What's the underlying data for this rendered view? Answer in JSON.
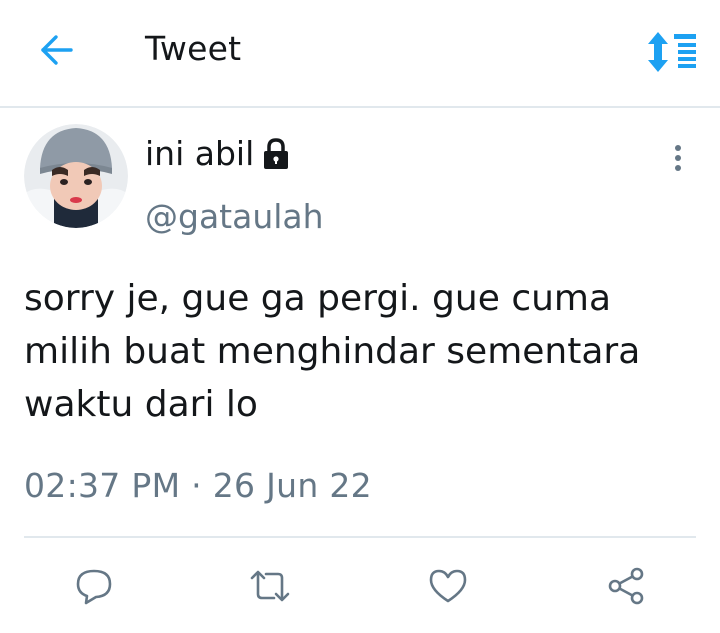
{
  "header": {
    "title": "Tweet",
    "back_icon": "arrow-left-icon",
    "sort_icon": "sort-icon",
    "accent_color": "#1da1f2"
  },
  "tweet": {
    "author": {
      "display_name": "ini abil",
      "handle": "@gataulah",
      "protected_icon": "lock-icon"
    },
    "text": "sorry je, gue ga pergi.  gue cuma\nmilih buat menghindar sementara\nwaktu dari lo",
    "timestamp": "02:37 PM · 26 Jun 22",
    "more_icon": "more-vertical-icon"
  },
  "actions": [
    {
      "name": "reply",
      "icon": "reply-icon"
    },
    {
      "name": "retweet",
      "icon": "retweet-icon"
    },
    {
      "name": "like",
      "icon": "heart-icon"
    },
    {
      "name": "share",
      "icon": "share-icon"
    }
  ],
  "colors": {
    "text_primary": "#14171a",
    "text_secondary": "#657786",
    "divider": "#e1e8ed",
    "icon_gray": "#657786"
  }
}
